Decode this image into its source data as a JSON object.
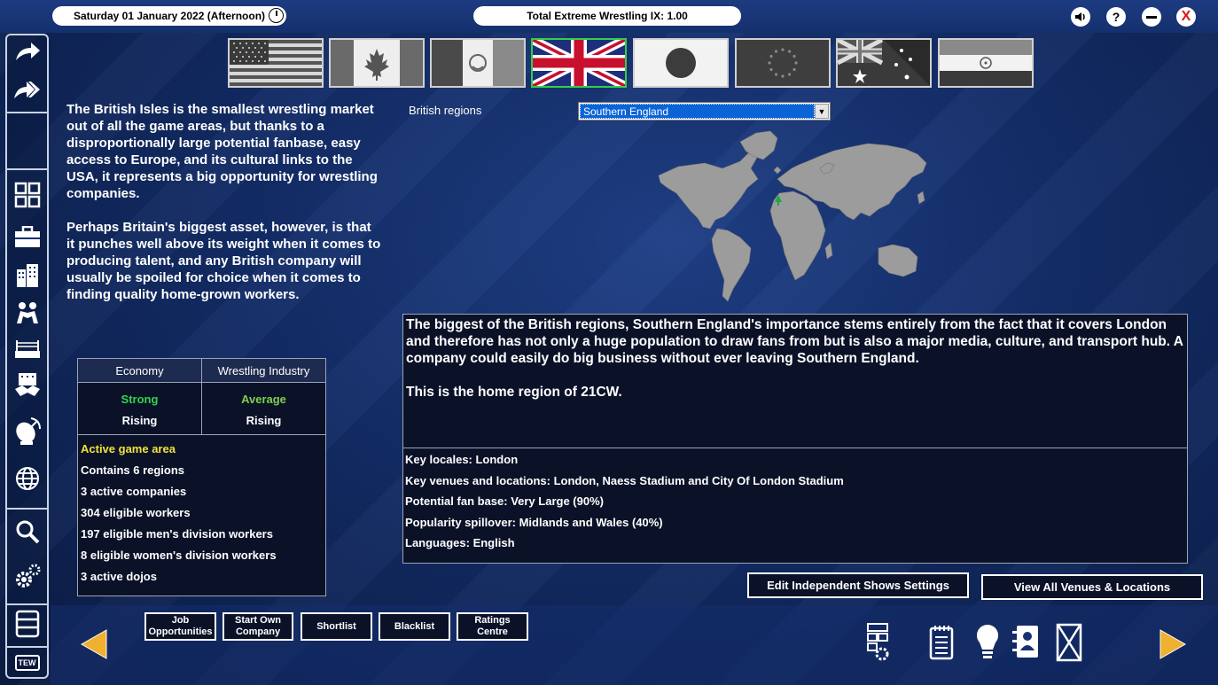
{
  "header": {
    "date": "Saturday 01 January 2022 (Afternoon)",
    "title": "Total Extreme Wrestling IX: 1.00",
    "help_symbol": "?",
    "close_symbol": "X"
  },
  "left_sidebar": {
    "items": [
      "forward-arrow-icon",
      "double-forward-arrow-icon",
      "grid-icon",
      "briefcase-icon",
      "buildings-icon",
      "wrestlers-icon",
      "ring-icon",
      "handshake-icon",
      "satellite-icon",
      "globe-icon",
      "search-icon",
      "gears-icon",
      "database-icon",
      "tew-logo"
    ],
    "logo_text": "TEW"
  },
  "flags": [
    "USA",
    "Canada",
    "Mexico",
    "United Kingdom",
    "Japan",
    "Europe",
    "Oceania",
    "India"
  ],
  "selected_flag": "United Kingdom",
  "intro": {
    "paragraph1": "The British Isles is the smallest wrestling market out of all the game areas, but thanks to a disproportionally large potential fanbase, easy access to Europe, and its cultural links to the USA, it represents a big opportunity for wrestling companies.",
    "paragraph2": "Perhaps Britain's biggest asset, however, is that it punches well above its weight when it comes to producing talent, and any British company will usually be spoiled for choice when it comes to finding quality home-grown workers."
  },
  "stats": {
    "economy_header": "Economy",
    "industry_header": "Wrestling Industry",
    "economy_status": "Strong",
    "economy_trend": "Rising",
    "industry_status": "Average",
    "industry_trend": "Rising",
    "active_label": "Active game area",
    "lines": [
      "Contains 6 regions",
      "3 active companies",
      "304 eligible workers",
      "197 eligible men's division workers",
      "8 eligible women's division workers",
      "3 active dojos"
    ],
    "colors": {
      "strong": "#34d24a",
      "average": "#7fd04a",
      "active": "#f2e13a"
    }
  },
  "regions": {
    "label": "British regions",
    "selected": "Southern England"
  },
  "description": {
    "body": "The biggest of the British regions, Southern England's importance stems entirely from the fact that it covers London and therefore has not only a huge population to draw fans from but is also a major media, culture, and transport hub. A company could easily do big business without ever leaving Southern England.",
    "home": "This is the home region of 21CW.",
    "key_locales": "Key locales: London",
    "key_venues": "Key venues and locations: London, Naess Stadium and City Of London Stadium",
    "fan_base": "Potential fan base: Very Large (90%)",
    "spillover": "Popularity spillover: Midlands and Wales (40%)",
    "languages": "Languages: English"
  },
  "actions": {
    "edit_shows": "Edit Independent Shows Settings",
    "view_venues": "View All Venues & Locations"
  },
  "bottom_buttons": {
    "job_line1": "Job",
    "job_line2": "Opportunities",
    "start_line1": "Start Own",
    "start_line2": "Company",
    "shortlist": "Shortlist",
    "blacklist": "Blacklist",
    "ratings_line1": "Ratings",
    "ratings_line2": "Centre"
  },
  "bottom_icons": [
    "settings-grid-icon",
    "notepad-icon",
    "lightbulb-icon",
    "contacts-icon",
    "hourglass-icon"
  ],
  "accent_color": "#f0b030"
}
